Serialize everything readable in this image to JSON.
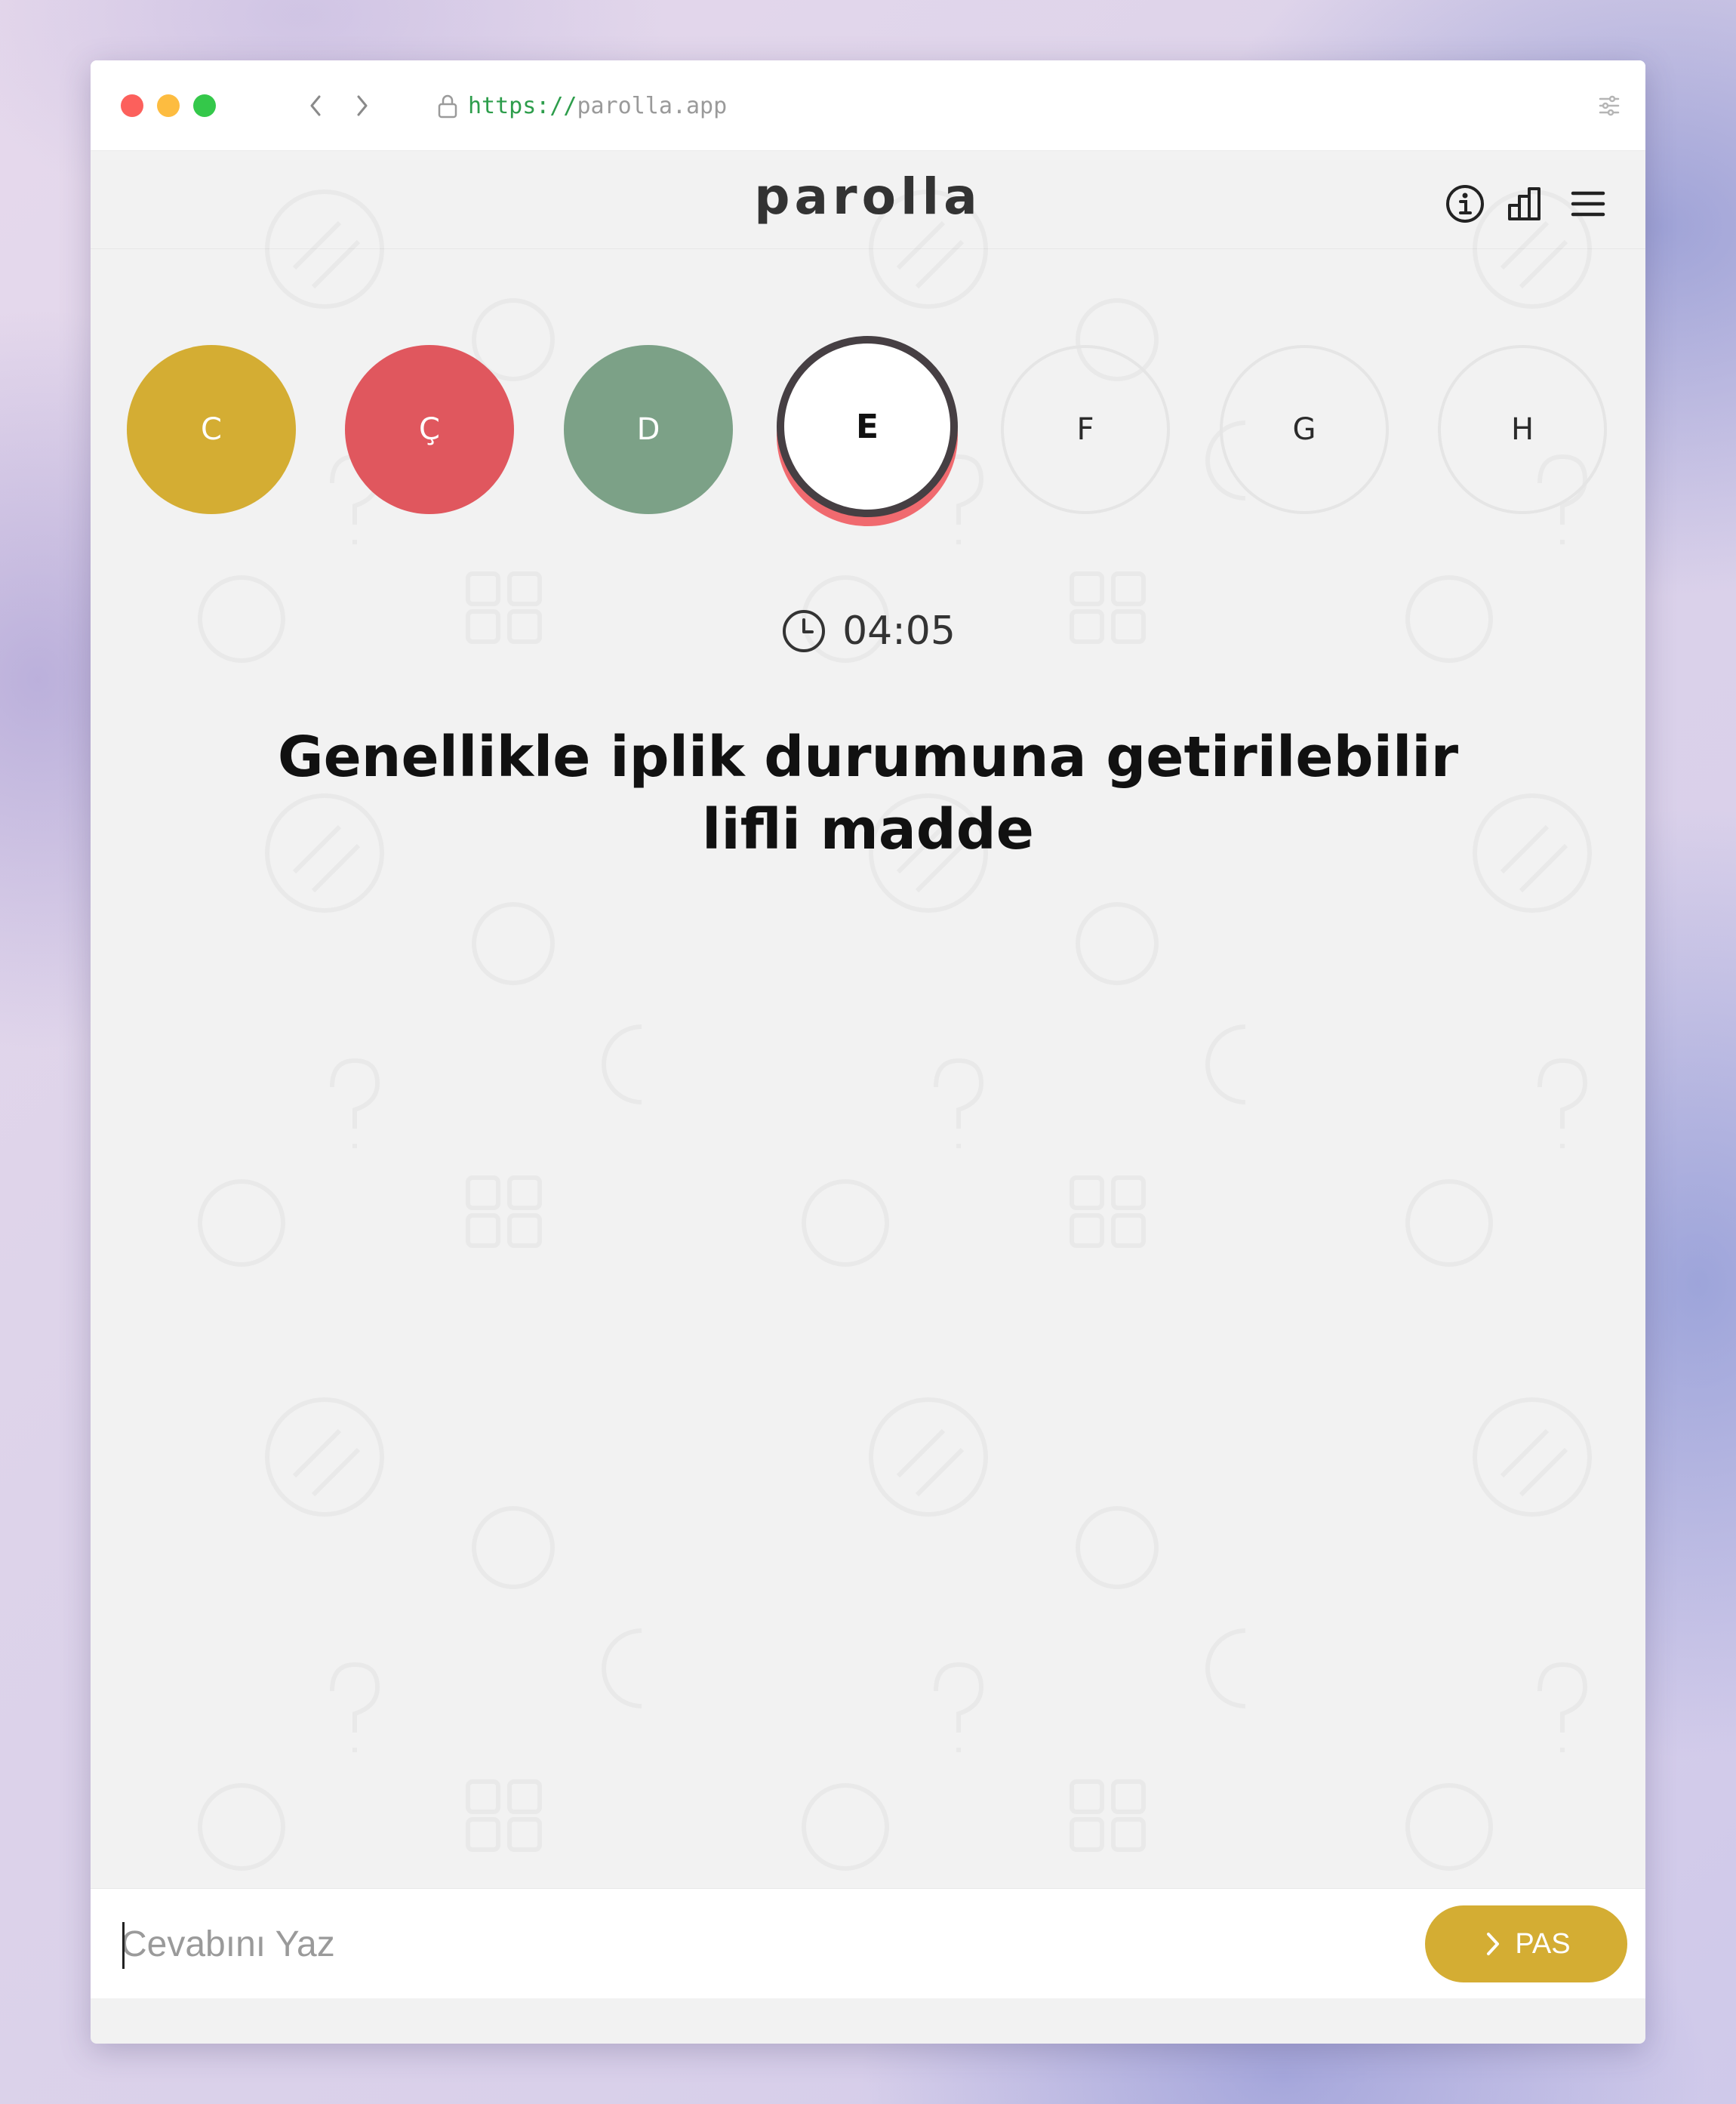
{
  "browser": {
    "url_scheme": "https://",
    "url_host": "parolla.app"
  },
  "app": {
    "logo": "parolla"
  },
  "letters": [
    {
      "label": "C",
      "status": "correct"
    },
    {
      "label": "Ç",
      "status": "wrong"
    },
    {
      "label": "D",
      "status": "passed"
    },
    {
      "label": "E",
      "status": "current"
    },
    {
      "label": "F",
      "status": "pending"
    },
    {
      "label": "G",
      "status": "pending"
    },
    {
      "label": "H",
      "status": "pending"
    }
  ],
  "timer": {
    "text": "04:05"
  },
  "question": {
    "line1": "Genellikle iplik durumuna getirilebilir",
    "line2": "lifli madde"
  },
  "answer": {
    "placeholder": "Cevabını Yaz",
    "value": ""
  },
  "pass_button": {
    "label": "PAS"
  },
  "colors": {
    "correct": "#d4ad33",
    "wrong": "#e0575e",
    "passed": "#7ca187",
    "current_ring": "#463f43",
    "current_shadow": "#f06a6f",
    "pass_button": "#d4ad33"
  },
  "icons": [
    "lock-icon",
    "chevron-left-icon",
    "chevron-right-icon",
    "settings-sliders-icon",
    "info-icon",
    "stats-chart-icon",
    "hamburger-menu-icon",
    "clock-icon",
    "chevron-right-icon"
  ]
}
